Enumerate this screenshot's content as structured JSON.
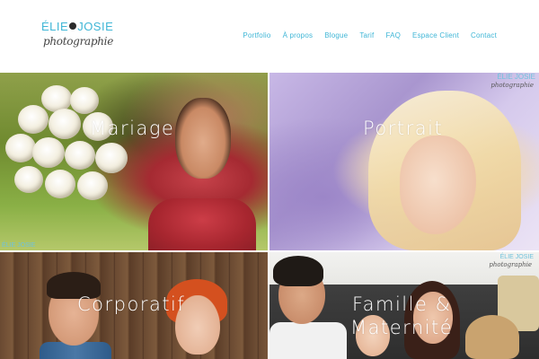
{
  "header": {
    "logo_line1_left": "ÉLIE",
    "logo_line1_right": "JOSIE",
    "logo_line2": "photographie"
  },
  "nav": {
    "items": [
      {
        "label": "Portfolio"
      },
      {
        "label": "À propos"
      },
      {
        "label": "Blogue"
      },
      {
        "label": "Tarif"
      },
      {
        "label": "FAQ"
      },
      {
        "label": "Espace Client"
      },
      {
        "label": "Contact"
      }
    ]
  },
  "tiles": [
    {
      "label": "Mariage"
    },
    {
      "label": "Portrait"
    },
    {
      "label": "Corporatif"
    },
    {
      "label_line1": "Famille &",
      "label_line2": "Maternité"
    }
  ],
  "watermarks": {
    "top_left_tile_bottom": "ÉLIE JOSIE",
    "portrait_top": "ÉLIE JOSIE",
    "portrait_script": "photographie",
    "famille_top": "ÉLIE JOSIE",
    "famille_script": "photographie"
  },
  "colors": {
    "accent": "#3fb6d6",
    "text_dark": "#444444",
    "tile_text": "#ffffff"
  }
}
